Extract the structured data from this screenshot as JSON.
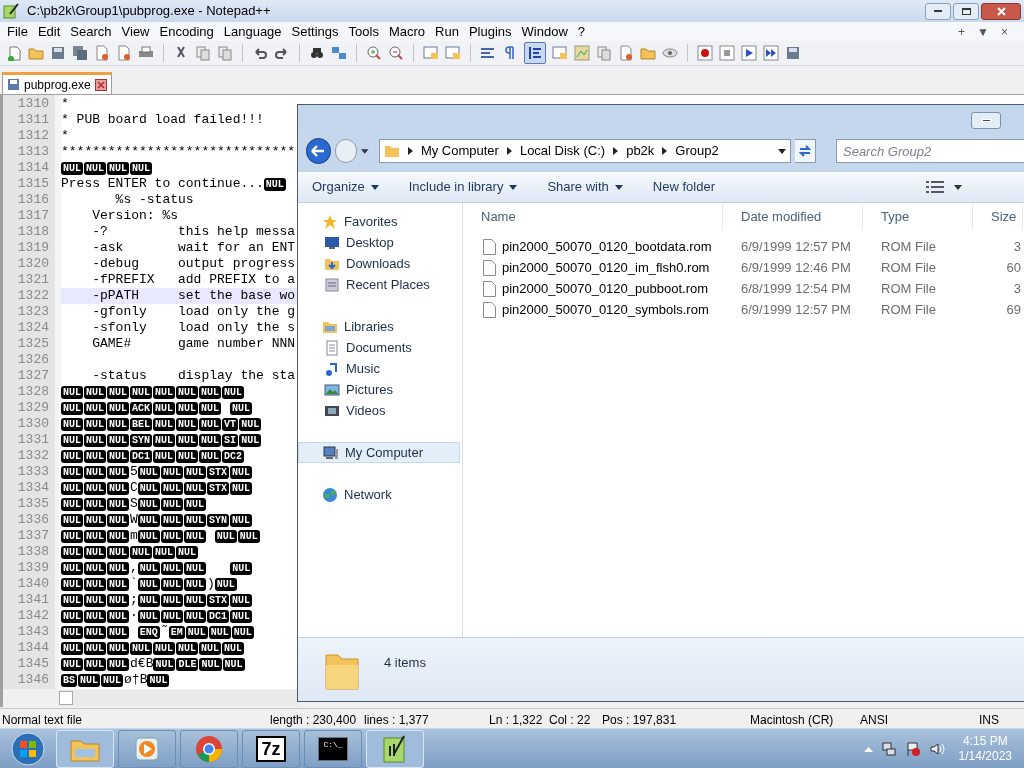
{
  "notepad": {
    "title": "C:\\pb2k\\Group1\\pubprog.exe - Notepad++",
    "menu": [
      "File",
      "Edit",
      "Search",
      "View",
      "Encoding",
      "Language",
      "Settings",
      "Tools",
      "Macro",
      "Run",
      "Plugins",
      "Window",
      "?"
    ],
    "menu_right": [
      "+",
      "▼",
      "×"
    ],
    "tabs": [
      {
        "label": "pubprog.exe",
        "selected": true
      }
    ],
    "lines": [
      {
        "number": "1310",
        "current": false,
        "segments": [
          {
            "kind": "text",
            "text": "*"
          }
        ]
      },
      {
        "number": "1311",
        "current": false,
        "segments": [
          {
            "kind": "text",
            "text": "* PUB board load failed!!!"
          }
        ]
      },
      {
        "number": "1312",
        "current": false,
        "segments": [
          {
            "kind": "text",
            "text": "*"
          }
        ]
      },
      {
        "number": "1313",
        "current": false,
        "segments": [
          {
            "kind": "text",
            "text": "******************************"
          }
        ]
      },
      {
        "number": "1314",
        "current": false,
        "segments": [
          {
            "kind": "ctrl",
            "text": "NUL"
          },
          {
            "kind": "ctrl",
            "text": "NUL"
          },
          {
            "kind": "ctrl",
            "text": "NUL"
          },
          {
            "kind": "ctrl",
            "text": "NUL"
          }
        ]
      },
      {
        "number": "1315",
        "current": false,
        "segments": [
          {
            "kind": "text",
            "text": "Press ENTER to continue..."
          },
          {
            "kind": "ctrl",
            "text": "NUL"
          }
        ]
      },
      {
        "number": "1316",
        "current": false,
        "segments": [
          {
            "kind": "text",
            "text": "       %s -status"
          }
        ]
      },
      {
        "number": "1317",
        "current": false,
        "segments": [
          {
            "kind": "text",
            "text": "    Version: %s"
          }
        ]
      },
      {
        "number": "1318",
        "current": false,
        "segments": [
          {
            "kind": "text",
            "text": "    -?         this help messa"
          }
        ]
      },
      {
        "number": "1319",
        "current": false,
        "segments": [
          {
            "kind": "text",
            "text": "    -ask       wait for an ENT"
          }
        ]
      },
      {
        "number": "1320",
        "current": false,
        "segments": [
          {
            "kind": "text",
            "text": "    -debug     output progress"
          }
        ]
      },
      {
        "number": "1321",
        "current": false,
        "segments": [
          {
            "kind": "text",
            "text": "    -fPREFIX   add PREFIX to a"
          }
        ]
      },
      {
        "number": "1322",
        "current": true,
        "segments": [
          {
            "kind": "text",
            "text": "    -pPATH     set the base wo"
          }
        ]
      },
      {
        "number": "1323",
        "current": false,
        "segments": [
          {
            "kind": "text",
            "text": "    -gfonly    load only the g"
          }
        ]
      },
      {
        "number": "1324",
        "current": false,
        "segments": [
          {
            "kind": "text",
            "text": "    -sfonly    load only the s"
          }
        ]
      },
      {
        "number": "1325",
        "current": false,
        "segments": [
          {
            "kind": "text",
            "text": "    GAME#      game number NNN"
          }
        ]
      },
      {
        "number": "1326",
        "current": false
      },
      {
        "number": "1327",
        "current": false,
        "segments": [
          {
            "kind": "text",
            "text": "    -status    display the sta"
          }
        ]
      },
      {
        "number": "1328",
        "current": false,
        "segments": [
          {
            "kind": "ctrl",
            "text": "NUL"
          },
          {
            "kind": "ctrl",
            "text": "NUL"
          },
          {
            "kind": "ctrl",
            "text": "NUL"
          },
          {
            "kind": "ctrl",
            "text": "NUL"
          },
          {
            "kind": "ctrl",
            "text": "NUL"
          },
          {
            "kind": "ctrl",
            "text": "NUL"
          },
          {
            "kind": "ctrl",
            "text": "NUL"
          },
          {
            "kind": "ctrl",
            "text": "NUL"
          }
        ]
      },
      {
        "number": "1329",
        "current": false,
        "segments": [
          {
            "kind": "ctrl",
            "text": "NUL"
          },
          {
            "kind": "ctrl",
            "text": "NUL"
          },
          {
            "kind": "ctrl",
            "text": "NUL"
          },
          {
            "kind": "ctrl",
            "text": "ACK"
          },
          {
            "kind": "ctrl",
            "text": "NUL"
          },
          {
            "kind": "ctrl",
            "text": "NUL"
          },
          {
            "kind": "ctrl",
            "text": "NUL"
          },
          {
            "kind": "space"
          },
          {
            "kind": "ctrl",
            "text": "NUL"
          }
        ]
      },
      {
        "number": "1330",
        "current": false,
        "segments": [
          {
            "kind": "ctrl",
            "text": "NUL"
          },
          {
            "kind": "ctrl",
            "text": "NUL"
          },
          {
            "kind": "ctrl",
            "text": "NUL"
          },
          {
            "kind": "ctrl",
            "text": "BEL"
          },
          {
            "kind": "ctrl",
            "text": "NUL"
          },
          {
            "kind": "ctrl",
            "text": "NUL"
          },
          {
            "kind": "ctrl",
            "text": "NUL"
          },
          {
            "kind": "ctrl",
            "text": "VT"
          },
          {
            "kind": "ctrl",
            "text": "NUL"
          }
        ]
      },
      {
        "number": "1331",
        "current": false,
        "segments": [
          {
            "kind": "ctrl",
            "text": "NUL"
          },
          {
            "kind": "ctrl",
            "text": "NUL"
          },
          {
            "kind": "ctrl",
            "text": "NUL"
          },
          {
            "kind": "ctrl",
            "text": "SYN"
          },
          {
            "kind": "ctrl",
            "text": "NUL"
          },
          {
            "kind": "ctrl",
            "text": "NUL"
          },
          {
            "kind": "ctrl",
            "text": "NUL"
          },
          {
            "kind": "ctrl",
            "text": "SI"
          },
          {
            "kind": "ctrl",
            "text": "NUL"
          }
        ]
      },
      {
        "number": "1332",
        "current": false,
        "segments": [
          {
            "kind": "ctrl",
            "text": "NUL"
          },
          {
            "kind": "ctrl",
            "text": "NUL"
          },
          {
            "kind": "ctrl",
            "text": "NUL"
          },
          {
            "kind": "ctrl",
            "text": "DC1"
          },
          {
            "kind": "ctrl",
            "text": "NUL"
          },
          {
            "kind": "ctrl",
            "text": "NUL"
          },
          {
            "kind": "ctrl",
            "text": "NUL"
          },
          {
            "kind": "ctrl",
            "text": "DC2"
          }
        ]
      },
      {
        "number": "1333",
        "current": false,
        "segments": [
          {
            "kind": "ctrl",
            "text": "NUL"
          },
          {
            "kind": "ctrl",
            "text": "NUL"
          },
          {
            "kind": "ctrl",
            "text": "NUL"
          },
          {
            "kind": "text",
            "text": "5"
          },
          {
            "kind": "ctrl",
            "text": "NUL"
          },
          {
            "kind": "ctrl",
            "text": "NUL"
          },
          {
            "kind": "ctrl",
            "text": "NUL"
          },
          {
            "kind": "ctrl",
            "text": "STX"
          },
          {
            "kind": "ctrl",
            "text": "NUL"
          }
        ]
      },
      {
        "number": "1334",
        "current": false,
        "segments": [
          {
            "kind": "ctrl",
            "text": "NUL"
          },
          {
            "kind": "ctrl",
            "text": "NUL"
          },
          {
            "kind": "ctrl",
            "text": "NUL"
          },
          {
            "kind": "text",
            "text": "C"
          },
          {
            "kind": "ctrl",
            "text": "NUL"
          },
          {
            "kind": "ctrl",
            "text": "NUL"
          },
          {
            "kind": "ctrl",
            "text": "NUL"
          },
          {
            "kind": "ctrl",
            "text": "STX"
          },
          {
            "kind": "ctrl",
            "text": "NUL"
          }
        ]
      },
      {
        "number": "1335",
        "current": false,
        "segments": [
          {
            "kind": "ctrl",
            "text": "NUL"
          },
          {
            "kind": "ctrl",
            "text": "NUL"
          },
          {
            "kind": "ctrl",
            "text": "NUL"
          },
          {
            "kind": "text",
            "text": "S"
          },
          {
            "kind": "ctrl",
            "text": "NUL"
          },
          {
            "kind": "ctrl",
            "text": "NUL"
          },
          {
            "kind": "ctrl",
            "text": "NUL"
          }
        ]
      },
      {
        "number": "1336",
        "current": false,
        "segments": [
          {
            "kind": "ctrl",
            "text": "NUL"
          },
          {
            "kind": "ctrl",
            "text": "NUL"
          },
          {
            "kind": "ctrl",
            "text": "NUL"
          },
          {
            "kind": "text",
            "text": "W"
          },
          {
            "kind": "ctrl",
            "text": "NUL"
          },
          {
            "kind": "ctrl",
            "text": "NUL"
          },
          {
            "kind": "ctrl",
            "text": "NUL"
          },
          {
            "kind": "ctrl",
            "text": "SYN"
          },
          {
            "kind": "ctrl",
            "text": "NUL"
          }
        ]
      },
      {
        "number": "1337",
        "current": false,
        "segments": [
          {
            "kind": "ctrl",
            "text": "NUL"
          },
          {
            "kind": "ctrl",
            "text": "NUL"
          },
          {
            "kind": "ctrl",
            "text": "NUL"
          },
          {
            "kind": "text",
            "text": "m"
          },
          {
            "kind": "ctrl",
            "text": "NUL"
          },
          {
            "kind": "ctrl",
            "text": "NUL"
          },
          {
            "kind": "ctrl",
            "text": "NUL"
          },
          {
            "kind": "space"
          },
          {
            "kind": "ctrl",
            "text": "NUL"
          },
          {
            "kind": "ctrl",
            "text": "NUL"
          }
        ]
      },
      {
        "number": "1338",
        "current": false,
        "segments": [
          {
            "kind": "ctrl",
            "text": "NUL"
          },
          {
            "kind": "ctrl",
            "text": "NUL"
          },
          {
            "kind": "ctrl",
            "text": "NUL"
          },
          {
            "kind": "ctrl",
            "text": "NUL"
          },
          {
            "kind": "ctrl",
            "text": "NUL"
          },
          {
            "kind": "ctrl",
            "text": "NUL"
          }
        ]
      },
      {
        "number": "1339",
        "current": false,
        "segments": [
          {
            "kind": "ctrl",
            "text": "NUL"
          },
          {
            "kind": "ctrl",
            "text": "NUL"
          },
          {
            "kind": "ctrl",
            "text": "NUL"
          },
          {
            "kind": "text",
            "text": ","
          },
          {
            "kind": "ctrl",
            "text": "NUL"
          },
          {
            "kind": "ctrl",
            "text": "NUL"
          },
          {
            "kind": "ctrl",
            "text": "NUL"
          },
          {
            "kind": "space"
          },
          {
            "kind": "space"
          },
          {
            "kind": "space"
          },
          {
            "kind": "ctrl",
            "text": "NUL"
          }
        ]
      },
      {
        "number": "1340",
        "current": false,
        "segments": [
          {
            "kind": "ctrl",
            "text": "NUL"
          },
          {
            "kind": "ctrl",
            "text": "NUL"
          },
          {
            "kind": "ctrl",
            "text": "NUL"
          },
          {
            "kind": "text",
            "text": "`"
          },
          {
            "kind": "ctrl",
            "text": "NUL"
          },
          {
            "kind": "ctrl",
            "text": "NUL"
          },
          {
            "kind": "ctrl",
            "text": "NUL"
          },
          {
            "kind": "text",
            "text": ")"
          },
          {
            "kind": "ctrl",
            "text": "NUL"
          }
        ]
      },
      {
        "number": "1341",
        "current": false,
        "segments": [
          {
            "kind": "ctrl",
            "text": "NUL"
          },
          {
            "kind": "ctrl",
            "text": "NUL"
          },
          {
            "kind": "ctrl",
            "text": "NUL"
          },
          {
            "kind": "text",
            "text": ";"
          },
          {
            "kind": "ctrl",
            "text": "NUL"
          },
          {
            "kind": "ctrl",
            "text": "NUL"
          },
          {
            "kind": "ctrl",
            "text": "NUL"
          },
          {
            "kind": "ctrl",
            "text": "STX"
          },
          {
            "kind": "ctrl",
            "text": "NUL"
          }
        ]
      },
      {
        "number": "1342",
        "current": false,
        "segments": [
          {
            "kind": "ctrl",
            "text": "NUL"
          },
          {
            "kind": "ctrl",
            "text": "NUL"
          },
          {
            "kind": "ctrl",
            "text": "NUL"
          },
          {
            "kind": "text",
            "text": "·"
          },
          {
            "kind": "ctrl",
            "text": "NUL"
          },
          {
            "kind": "ctrl",
            "text": "NUL"
          },
          {
            "kind": "ctrl",
            "text": "NUL"
          },
          {
            "kind": "ctrl",
            "text": "DC1"
          },
          {
            "kind": "ctrl",
            "text": "NUL"
          }
        ]
      },
      {
        "number": "1343",
        "current": false,
        "segments": [
          {
            "kind": "ctrl",
            "text": "NUL"
          },
          {
            "kind": "ctrl",
            "text": "NUL"
          },
          {
            "kind": "ctrl",
            "text": "NUL"
          },
          {
            "kind": "space"
          },
          {
            "kind": "ctrl",
            "text": "ENQ"
          },
          {
            "kind": "text",
            "text": "˜"
          },
          {
            "kind": "ctrl",
            "text": "EM"
          },
          {
            "kind": "ctrl",
            "text": "NUL"
          },
          {
            "kind": "ctrl",
            "text": "NUL"
          },
          {
            "kind": "ctrl",
            "text": "NUL"
          }
        ]
      },
      {
        "number": "1344",
        "current": false,
        "segments": [
          {
            "kind": "ctrl",
            "text": "NUL"
          },
          {
            "kind": "ctrl",
            "text": "NUL"
          },
          {
            "kind": "ctrl",
            "text": "NUL"
          },
          {
            "kind": "ctrl",
            "text": "NUL"
          },
          {
            "kind": "ctrl",
            "text": "NUL"
          },
          {
            "kind": "ctrl",
            "text": "NUL"
          },
          {
            "kind": "ctrl",
            "text": "NUL"
          },
          {
            "kind": "ctrl",
            "text": "NUL"
          }
        ]
      },
      {
        "number": "1345",
        "current": false,
        "segments": [
          {
            "kind": "ctrl",
            "text": "NUL"
          },
          {
            "kind": "ctrl",
            "text": "NUL"
          },
          {
            "kind": "ctrl",
            "text": "NUL"
          },
          {
            "kind": "text",
            "text": "d€B"
          },
          {
            "kind": "ctrl",
            "text": "NUL"
          },
          {
            "kind": "ctrl",
            "text": "DLE"
          },
          {
            "kind": "ctrl",
            "text": "NUL"
          },
          {
            "kind": "ctrl",
            "text": "NUL"
          }
        ]
      },
      {
        "number": "1346",
        "current": false,
        "segments": [
          {
            "kind": "ctrl",
            "text": "BS"
          },
          {
            "kind": "ctrl",
            "text": "NUL"
          },
          {
            "kind": "ctrl",
            "text": "NUL"
          },
          {
            "kind": "text",
            "text": "ø†B"
          },
          {
            "kind": "ctrl",
            "text": "NUL"
          }
        ]
      }
    ],
    "status_bar": [
      "Normal text file",
      "length : 230,400",
      "lines : 1,377",
      "Ln : 1,322",
      "Col : 22",
      "Pos : 197,831",
      "Macintosh (CR)",
      "ANSI",
      "INS"
    ]
  },
  "explorer": {
    "breadcrumb": [
      "My Computer",
      "Local Disk (C:)",
      "pb2k",
      "Group2"
    ],
    "search": {
      "placeholder": "Search Group2"
    },
    "toolbar": [
      {
        "label": "Organize",
        "dropdown": true
      },
      {
        "label": "Include in library",
        "dropdown": true
      },
      {
        "label": "Share with",
        "dropdown": true
      },
      {
        "label": "New folder",
        "dropdown": false
      }
    ],
    "nav": [
      {
        "label": "Favorites",
        "kind": "favorites",
        "selected": false,
        "children": [
          {
            "label": "Desktop",
            "kind": "desktop",
            "selected": false
          },
          {
            "label": "Downloads",
            "kind": "downloads",
            "selected": false
          },
          {
            "label": "Recent Places",
            "kind": "recent",
            "selected": false
          }
        ]
      },
      {
        "label": "Libraries",
        "kind": "libraries",
        "selected": false,
        "children": [
          {
            "label": "Documents",
            "kind": "documents",
            "selected": false
          },
          {
            "label": "Music",
            "kind": "music",
            "selected": false
          },
          {
            "label": "Pictures",
            "kind": "pictures",
            "selected": false
          },
          {
            "label": "Videos",
            "kind": "videos",
            "selected": false
          }
        ]
      },
      {
        "label": "My Computer",
        "kind": "computer",
        "selected": true
      },
      {
        "label": "Network",
        "kind": "network",
        "selected": false
      }
    ],
    "columns": [
      "Name",
      "Date modified",
      "Type",
      "Size"
    ],
    "files": [
      {
        "name": "pin2000_50070_0120_bootdata.rom",
        "date": "6/9/1999 12:57 PM",
        "type": "ROM File",
        "size": "3"
      },
      {
        "name": "pin2000_50070_0120_im_flsh0.rom",
        "date": "6/9/1999 12:46 PM",
        "type": "ROM File",
        "size": "60"
      },
      {
        "name": "pin2000_50070_0120_pubboot.rom",
        "date": "6/8/1999 12:54 PM",
        "type": "ROM File",
        "size": "3"
      },
      {
        "name": "pin2000_50070_0120_symbols.rom",
        "date": "6/9/1999 12:57 PM",
        "type": "ROM File",
        "size": "69"
      }
    ],
    "item_count": "4 items"
  },
  "taskbar": {
    "apps": [
      {
        "kind": "explorer",
        "active": true
      },
      {
        "kind": "media",
        "active": false
      },
      {
        "kind": "chrome",
        "active": false
      },
      {
        "kind": "sevenzip",
        "label": "7z",
        "active": false
      },
      {
        "kind": "cmd",
        "label": "C:\\_",
        "active": false
      },
      {
        "kind": "notepad",
        "active": true
      }
    ],
    "time": "4:15 PM",
    "date": "1/14/2023"
  }
}
